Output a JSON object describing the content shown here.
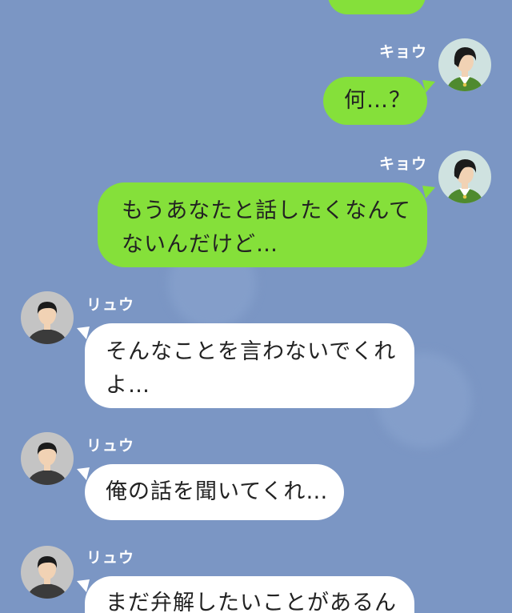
{
  "colors": {
    "background": "#7b96c4",
    "outgoing_bubble": "#85e03a",
    "incoming_bubble": "#ffffff"
  },
  "messages": [
    {
      "side": "outgoing",
      "sender": "",
      "text_lines": [
        ""
      ]
    },
    {
      "side": "outgoing",
      "sender": "キョウ",
      "avatar": "woman-avatar-icon",
      "text_lines": [
        "何…？"
      ]
    },
    {
      "side": "outgoing",
      "sender": "キョウ",
      "avatar": "woman-avatar-icon",
      "text_lines": [
        "もうあなたと話したくなんて",
        "ないんだけど…"
      ]
    },
    {
      "side": "incoming",
      "sender": "リュウ",
      "avatar": "man-avatar-icon",
      "text_lines": [
        "そんなことを言わないでくれ",
        "よ…"
      ]
    },
    {
      "side": "incoming",
      "sender": "リュウ",
      "avatar": "man-avatar-icon",
      "text_lines": [
        "俺の話を聞いてくれ…"
      ]
    },
    {
      "side": "incoming",
      "sender": "リュウ",
      "avatar": "man-avatar-icon",
      "text_lines": [
        "まだ弁解したいことがあるん"
      ]
    }
  ]
}
